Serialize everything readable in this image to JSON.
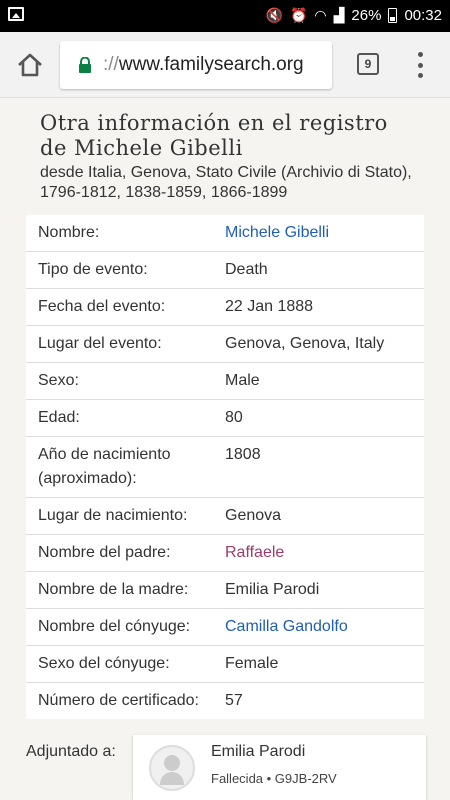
{
  "status_bar": {
    "battery": "26%",
    "time": "00:32"
  },
  "browser": {
    "url_scheme": "://",
    "url_host": "www.familysearch.org",
    "tab_count": "9"
  },
  "record": {
    "title_line1": "Otra información en el registro",
    "title_line2": "de Michele Gibelli",
    "subtitle": "desde Italia, Genova, Stato Civile (Archivio di Stato), 1796-1812, 1838-1859, 1866-1899",
    "rows": [
      {
        "label": "Nombre:",
        "value": "Michele Gibelli",
        "style": "link"
      },
      {
        "label": "Tipo de evento:",
        "value": "Death",
        "style": "plain"
      },
      {
        "label": "Fecha del evento:",
        "value": "22 Jan 1888",
        "style": "plain"
      },
      {
        "label": "Lugar del evento:",
        "value": "Genova, Genova, Italy",
        "style": "plain"
      },
      {
        "label": "Sexo:",
        "value": "Male",
        "style": "plain"
      },
      {
        "label": "Edad:",
        "value": "80",
        "style": "plain"
      },
      {
        "label": "Año de nacimiento (aproximado):",
        "value": "1808",
        "style": "plain"
      },
      {
        "label": "Lugar de nacimiento:",
        "value": "Genova",
        "style": "plain"
      },
      {
        "label": "Nombre del padre:",
        "value": "Raffaele",
        "style": "visited"
      },
      {
        "label": "Nombre de la madre:",
        "value": "Emilia Parodi",
        "style": "plain"
      },
      {
        "label": "Nombre del cónyuge:",
        "value": "Camilla Gandolfo",
        "style": "link"
      },
      {
        "label": "Sexo del cónyuge:",
        "value": "Female",
        "style": "plain"
      },
      {
        "label": "Número de certificado:",
        "value": "57",
        "style": "plain"
      }
    ]
  },
  "attached": {
    "label": "Adjuntado a:",
    "name": "Emilia Parodi",
    "meta": "Fallecida • G9JB-2RV"
  }
}
